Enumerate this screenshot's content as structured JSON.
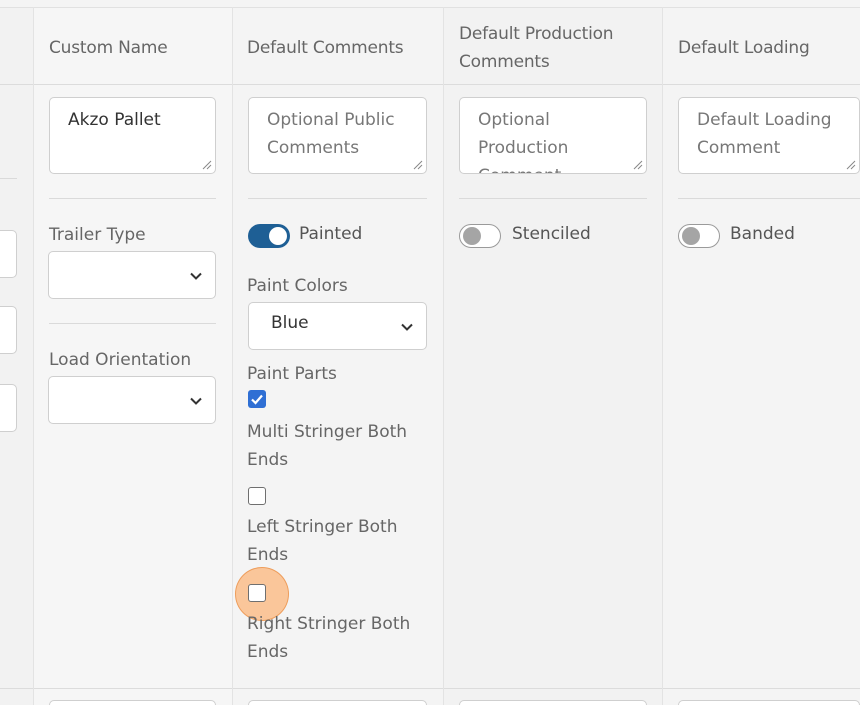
{
  "columns": {
    "custom_name": "Custom Name",
    "default_comments": "Default Comments",
    "default_production_comments": "Default Production Comments",
    "default_loading": "Default Loading"
  },
  "fields": {
    "custom_name_value": "Akzo Pallet",
    "public_comments_placeholder": "Optional Public Comments",
    "production_comments_placeholder": "Optional Production Comment...",
    "loading_comment_placeholder": "Default Loading Comment"
  },
  "labels": {
    "trailer_type": "Trailer Type",
    "load_orientation": "Load Orientation",
    "paint_colors": "Paint Colors",
    "paint_parts": "Paint Parts"
  },
  "toggles": {
    "painted": {
      "label": "Painted",
      "on": true
    },
    "stenciled": {
      "label": "Stenciled",
      "on": false
    },
    "banded": {
      "label": "Banded",
      "on": false
    }
  },
  "selects": {
    "trailer_type_value": "",
    "load_orientation_value": "",
    "paint_colors_value": "Blue"
  },
  "paint_parts": [
    {
      "label": "Multi Stringer Both Ends",
      "checked": true
    },
    {
      "label": "Left Stringer Both Ends",
      "checked": false
    },
    {
      "label": "Right Stringer Both Ends",
      "checked": false
    }
  ],
  "colors": {
    "toggle_on": "#1e5f95",
    "checkbox_checked": "#2f6fd4",
    "click_highlight": "#f5a15a"
  }
}
